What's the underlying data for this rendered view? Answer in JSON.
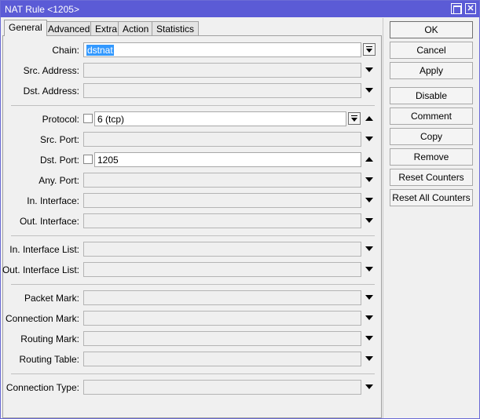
{
  "window": {
    "title": "NAT Rule <1205>"
  },
  "tabs": [
    "General",
    "Advanced",
    "Extra",
    "Action",
    "Statistics"
  ],
  "fields": {
    "chain": {
      "label": "Chain:",
      "value": "dstnat"
    },
    "src_address": {
      "label": "Src. Address:"
    },
    "dst_address": {
      "label": "Dst. Address:"
    },
    "protocol": {
      "label": "Protocol:",
      "value": "6 (tcp)"
    },
    "src_port": {
      "label": "Src. Port:"
    },
    "dst_port": {
      "label": "Dst. Port:",
      "value": "1205"
    },
    "any_port": {
      "label": "Any. Port:"
    },
    "in_interface": {
      "label": "In. Interface:"
    },
    "out_interface": {
      "label": "Out. Interface:"
    },
    "in_interface_list": {
      "label": "In. Interface List:"
    },
    "out_interface_list": {
      "label": "Out. Interface List:"
    },
    "packet_mark": {
      "label": "Packet Mark:"
    },
    "connection_mark": {
      "label": "Connection Mark:"
    },
    "routing_mark": {
      "label": "Routing Mark:"
    },
    "routing_table": {
      "label": "Routing Table:"
    },
    "connection_type": {
      "label": "Connection Type:"
    }
  },
  "buttons": {
    "ok": "OK",
    "cancel": "Cancel",
    "apply": "Apply",
    "disable": "Disable",
    "comment": "Comment",
    "copy": "Copy",
    "remove": "Remove",
    "reset_counters": "Reset Counters",
    "reset_all_counters": "Reset All Counters"
  },
  "colors": {
    "titlebar": "#5b5bd6",
    "selection": "#3399ff"
  }
}
